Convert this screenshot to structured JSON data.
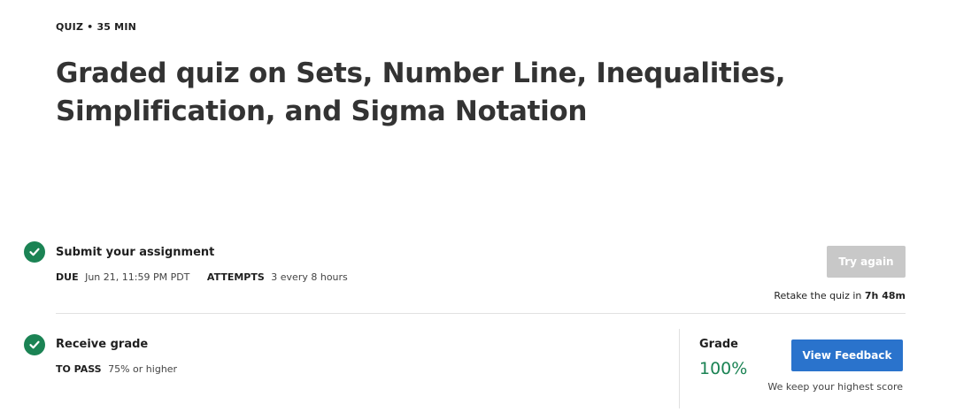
{
  "header": {
    "kicker": "QUIZ • 35 MIN",
    "title": "Graded quiz on Sets, Number Line, Inequalities, Simplification, and Sigma Notation"
  },
  "submit": {
    "title": "Submit your assignment",
    "due_label": "DUE",
    "due_value": "Jun 21, 11:59 PM PDT",
    "attempts_label": "ATTEMPTS",
    "attempts_value": "3 every 8 hours",
    "try_again_label": "Try again",
    "retake_prefix": "Retake the quiz in",
    "retake_time": "7h 48m"
  },
  "receive": {
    "title": "Receive grade",
    "to_pass_label": "TO PASS",
    "to_pass_value": "75% or higher",
    "grade_label": "Grade",
    "grade_value": "100%",
    "view_feedback_label": "View Feedback",
    "highest_note": "We keep your highest score"
  },
  "icons": {
    "step_complete": "check-circle-icon"
  },
  "colors": {
    "success": "#1b8354",
    "primary": "#2a73cc",
    "disabled": "#c8c8c8"
  }
}
